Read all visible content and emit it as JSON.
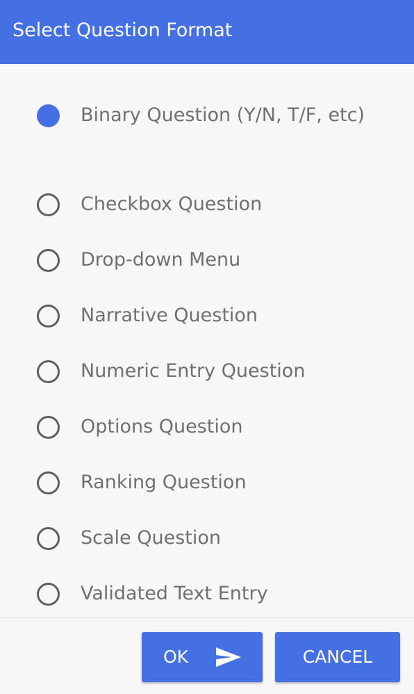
{
  "dialog": {
    "title": "Select Question Format"
  },
  "options": [
    {
      "label": "Binary Question (Y/N, T/F, etc)",
      "selected": true
    },
    {
      "label": "Checkbox Question",
      "selected": false
    },
    {
      "label": "Drop-down Menu",
      "selected": false
    },
    {
      "label": "Narrative Question",
      "selected": false
    },
    {
      "label": "Numeric Entry Question",
      "selected": false
    },
    {
      "label": "Options Question",
      "selected": false
    },
    {
      "label": "Ranking Question",
      "selected": false
    },
    {
      "label": "Scale Question",
      "selected": false
    },
    {
      "label": "Validated Text Entry",
      "selected": false
    }
  ],
  "footer": {
    "ok_label": "OK",
    "ok_icon": "send-icon",
    "cancel_label": "CANCEL"
  },
  "colors": {
    "accent": "#4570e3",
    "radio_border": "#5f5f5f",
    "label_text": "#707070",
    "background": "#f7f7f7"
  }
}
